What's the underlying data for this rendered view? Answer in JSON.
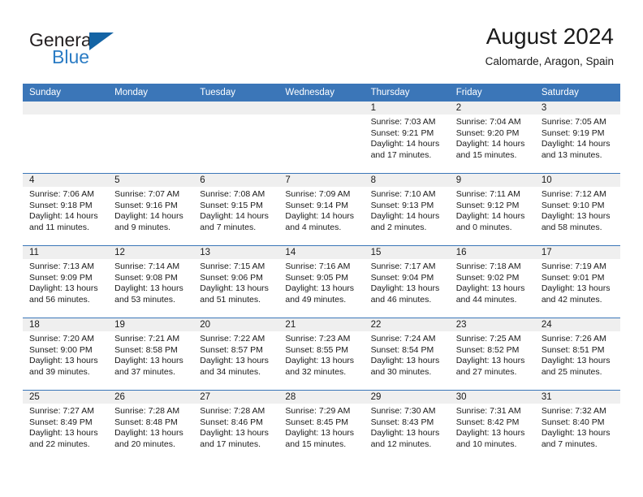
{
  "brand": {
    "name_part1": "General",
    "name_part2": "Blue",
    "logo_icon": "triangle-flag-icon"
  },
  "header": {
    "title": "August 2024",
    "location": "Calomarde, Aragon, Spain"
  },
  "calendar": {
    "weekday_headers": [
      "Sunday",
      "Monday",
      "Tuesday",
      "Wednesday",
      "Thursday",
      "Friday",
      "Saturday"
    ],
    "accent_color": "#3b76b8",
    "date_band_color": "#efefef",
    "weeks": [
      [
        {
          "day": "",
          "lines": []
        },
        {
          "day": "",
          "lines": []
        },
        {
          "day": "",
          "lines": []
        },
        {
          "day": "",
          "lines": []
        },
        {
          "day": "1",
          "lines": [
            "Sunrise: 7:03 AM",
            "Sunset: 9:21 PM",
            "Daylight: 14 hours",
            "and 17 minutes."
          ]
        },
        {
          "day": "2",
          "lines": [
            "Sunrise: 7:04 AM",
            "Sunset: 9:20 PM",
            "Daylight: 14 hours",
            "and 15 minutes."
          ]
        },
        {
          "day": "3",
          "lines": [
            "Sunrise: 7:05 AM",
            "Sunset: 9:19 PM",
            "Daylight: 14 hours",
            "and 13 minutes."
          ]
        }
      ],
      [
        {
          "day": "4",
          "lines": [
            "Sunrise: 7:06 AM",
            "Sunset: 9:18 PM",
            "Daylight: 14 hours",
            "and 11 minutes."
          ]
        },
        {
          "day": "5",
          "lines": [
            "Sunrise: 7:07 AM",
            "Sunset: 9:16 PM",
            "Daylight: 14 hours",
            "and 9 minutes."
          ]
        },
        {
          "day": "6",
          "lines": [
            "Sunrise: 7:08 AM",
            "Sunset: 9:15 PM",
            "Daylight: 14 hours",
            "and 7 minutes."
          ]
        },
        {
          "day": "7",
          "lines": [
            "Sunrise: 7:09 AM",
            "Sunset: 9:14 PM",
            "Daylight: 14 hours",
            "and 4 minutes."
          ]
        },
        {
          "day": "8",
          "lines": [
            "Sunrise: 7:10 AM",
            "Sunset: 9:13 PM",
            "Daylight: 14 hours",
            "and 2 minutes."
          ]
        },
        {
          "day": "9",
          "lines": [
            "Sunrise: 7:11 AM",
            "Sunset: 9:12 PM",
            "Daylight: 14 hours",
            "and 0 minutes."
          ]
        },
        {
          "day": "10",
          "lines": [
            "Sunrise: 7:12 AM",
            "Sunset: 9:10 PM",
            "Daylight: 13 hours",
            "and 58 minutes."
          ]
        }
      ],
      [
        {
          "day": "11",
          "lines": [
            "Sunrise: 7:13 AM",
            "Sunset: 9:09 PM",
            "Daylight: 13 hours",
            "and 56 minutes."
          ]
        },
        {
          "day": "12",
          "lines": [
            "Sunrise: 7:14 AM",
            "Sunset: 9:08 PM",
            "Daylight: 13 hours",
            "and 53 minutes."
          ]
        },
        {
          "day": "13",
          "lines": [
            "Sunrise: 7:15 AM",
            "Sunset: 9:06 PM",
            "Daylight: 13 hours",
            "and 51 minutes."
          ]
        },
        {
          "day": "14",
          "lines": [
            "Sunrise: 7:16 AM",
            "Sunset: 9:05 PM",
            "Daylight: 13 hours",
            "and 49 minutes."
          ]
        },
        {
          "day": "15",
          "lines": [
            "Sunrise: 7:17 AM",
            "Sunset: 9:04 PM",
            "Daylight: 13 hours",
            "and 46 minutes."
          ]
        },
        {
          "day": "16",
          "lines": [
            "Sunrise: 7:18 AM",
            "Sunset: 9:02 PM",
            "Daylight: 13 hours",
            "and 44 minutes."
          ]
        },
        {
          "day": "17",
          "lines": [
            "Sunrise: 7:19 AM",
            "Sunset: 9:01 PM",
            "Daylight: 13 hours",
            "and 42 minutes."
          ]
        }
      ],
      [
        {
          "day": "18",
          "lines": [
            "Sunrise: 7:20 AM",
            "Sunset: 9:00 PM",
            "Daylight: 13 hours",
            "and 39 minutes."
          ]
        },
        {
          "day": "19",
          "lines": [
            "Sunrise: 7:21 AM",
            "Sunset: 8:58 PM",
            "Daylight: 13 hours",
            "and 37 minutes."
          ]
        },
        {
          "day": "20",
          "lines": [
            "Sunrise: 7:22 AM",
            "Sunset: 8:57 PM",
            "Daylight: 13 hours",
            "and 34 minutes."
          ]
        },
        {
          "day": "21",
          "lines": [
            "Sunrise: 7:23 AM",
            "Sunset: 8:55 PM",
            "Daylight: 13 hours",
            "and 32 minutes."
          ]
        },
        {
          "day": "22",
          "lines": [
            "Sunrise: 7:24 AM",
            "Sunset: 8:54 PM",
            "Daylight: 13 hours",
            "and 30 minutes."
          ]
        },
        {
          "day": "23",
          "lines": [
            "Sunrise: 7:25 AM",
            "Sunset: 8:52 PM",
            "Daylight: 13 hours",
            "and 27 minutes."
          ]
        },
        {
          "day": "24",
          "lines": [
            "Sunrise: 7:26 AM",
            "Sunset: 8:51 PM",
            "Daylight: 13 hours",
            "and 25 minutes."
          ]
        }
      ],
      [
        {
          "day": "25",
          "lines": [
            "Sunrise: 7:27 AM",
            "Sunset: 8:49 PM",
            "Daylight: 13 hours",
            "and 22 minutes."
          ]
        },
        {
          "day": "26",
          "lines": [
            "Sunrise: 7:28 AM",
            "Sunset: 8:48 PM",
            "Daylight: 13 hours",
            "and 20 minutes."
          ]
        },
        {
          "day": "27",
          "lines": [
            "Sunrise: 7:28 AM",
            "Sunset: 8:46 PM",
            "Daylight: 13 hours",
            "and 17 minutes."
          ]
        },
        {
          "day": "28",
          "lines": [
            "Sunrise: 7:29 AM",
            "Sunset: 8:45 PM",
            "Daylight: 13 hours",
            "and 15 minutes."
          ]
        },
        {
          "day": "29",
          "lines": [
            "Sunrise: 7:30 AM",
            "Sunset: 8:43 PM",
            "Daylight: 13 hours",
            "and 12 minutes."
          ]
        },
        {
          "day": "30",
          "lines": [
            "Sunrise: 7:31 AM",
            "Sunset: 8:42 PM",
            "Daylight: 13 hours",
            "and 10 minutes."
          ]
        },
        {
          "day": "31",
          "lines": [
            "Sunrise: 7:32 AM",
            "Sunset: 8:40 PM",
            "Daylight: 13 hours",
            "and 7 minutes."
          ]
        }
      ]
    ]
  }
}
